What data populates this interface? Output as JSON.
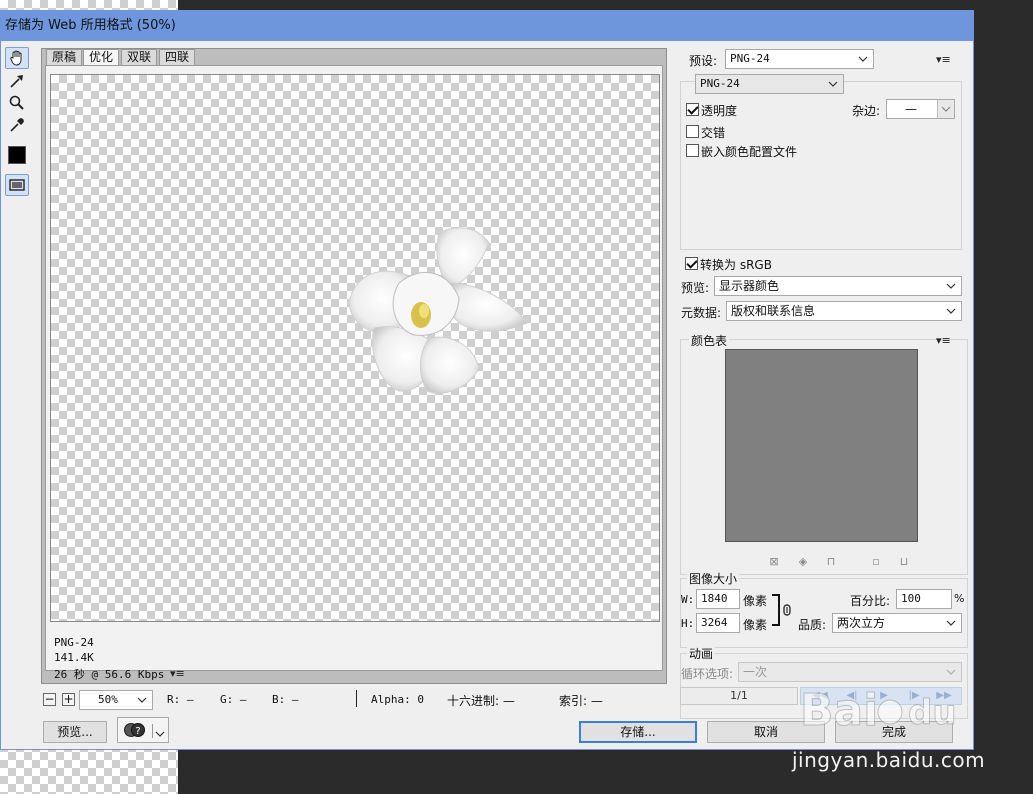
{
  "window": {
    "title": "存储为 Web 所用格式 (50%)"
  },
  "tabs": [
    {
      "label": "原稿",
      "active": false
    },
    {
      "label": "优化",
      "active": true
    },
    {
      "label": "双联",
      "active": false
    },
    {
      "label": "四联",
      "active": false
    }
  ],
  "tools": [
    {
      "name": "hand-tool",
      "icon": "hand-icon",
      "active": true
    },
    {
      "name": "slice-select-tool",
      "icon": "slice-select-icon",
      "active": false
    },
    {
      "name": "zoom-tool",
      "icon": "magnifier-icon",
      "active": false
    },
    {
      "name": "eyedropper-tool",
      "icon": "eyedropper-icon",
      "active": false
    },
    {
      "name": "eyedropper-color",
      "icon": "color-swatch",
      "color": "#000000"
    },
    {
      "name": "toggle-slices-visibility",
      "icon": "slices-visibility-icon",
      "active": false
    }
  ],
  "preview_info": {
    "format": "PNG-24",
    "size": "141.4K",
    "download": "26 秒 @ 56.6 Kbps"
  },
  "statusbar": {
    "zoom": "50%",
    "r": "R: —",
    "g": "G: —",
    "b": "B: —",
    "alpha": "Alpha: 0",
    "hex": "十六进制: —",
    "index": "索引: —"
  },
  "bottom_buttons": {
    "preview": "预览...",
    "save": "存储...",
    "cancel": "取消",
    "done": "完成"
  },
  "settings": {
    "preset_label": "预设:",
    "preset_value": "PNG-24",
    "format_value": "PNG-24",
    "transparency_label": "透明度",
    "transparency_checked": true,
    "matte_label": "杂边:",
    "matte_value": "—",
    "interlaced_label": "交错",
    "interlaced_checked": false,
    "embed_profile_label": "嵌入颜色配置文件",
    "embed_profile_checked": false,
    "convert_srgb_label": "转换为 sRGB",
    "convert_srgb_checked": true,
    "preview_label": "预览:",
    "preview_value": "显示器颜色",
    "metadata_label": "元数据:",
    "metadata_value": "版权和联系信息"
  },
  "color_table": {
    "title": "颜色表",
    "swatch_bg": "#808080",
    "icons": [
      "map-transparent-icon",
      "web-snap-icon",
      "lock-color-icon",
      "new-color-icon",
      "delete-color-icon"
    ]
  },
  "image_size": {
    "title": "图像大小",
    "w_label": "W:",
    "w_value": "1840",
    "h_label": "H:",
    "h_value": "3264",
    "unit": "像素",
    "percent_label": "百分比:",
    "percent_value": "100",
    "percent_unit": "%",
    "quality_label": "品质:",
    "quality_value": "两次立方"
  },
  "animation": {
    "title": "动画",
    "loop_label": "循环选项:",
    "loop_value": "一次",
    "frame": "1/1"
  },
  "watermark": {
    "site": "jingyan.baidu.com"
  },
  "colors": {
    "titlebar": "#6d96dc",
    "accent": "#3c7fd8",
    "dialog_bg": "#efefef"
  }
}
